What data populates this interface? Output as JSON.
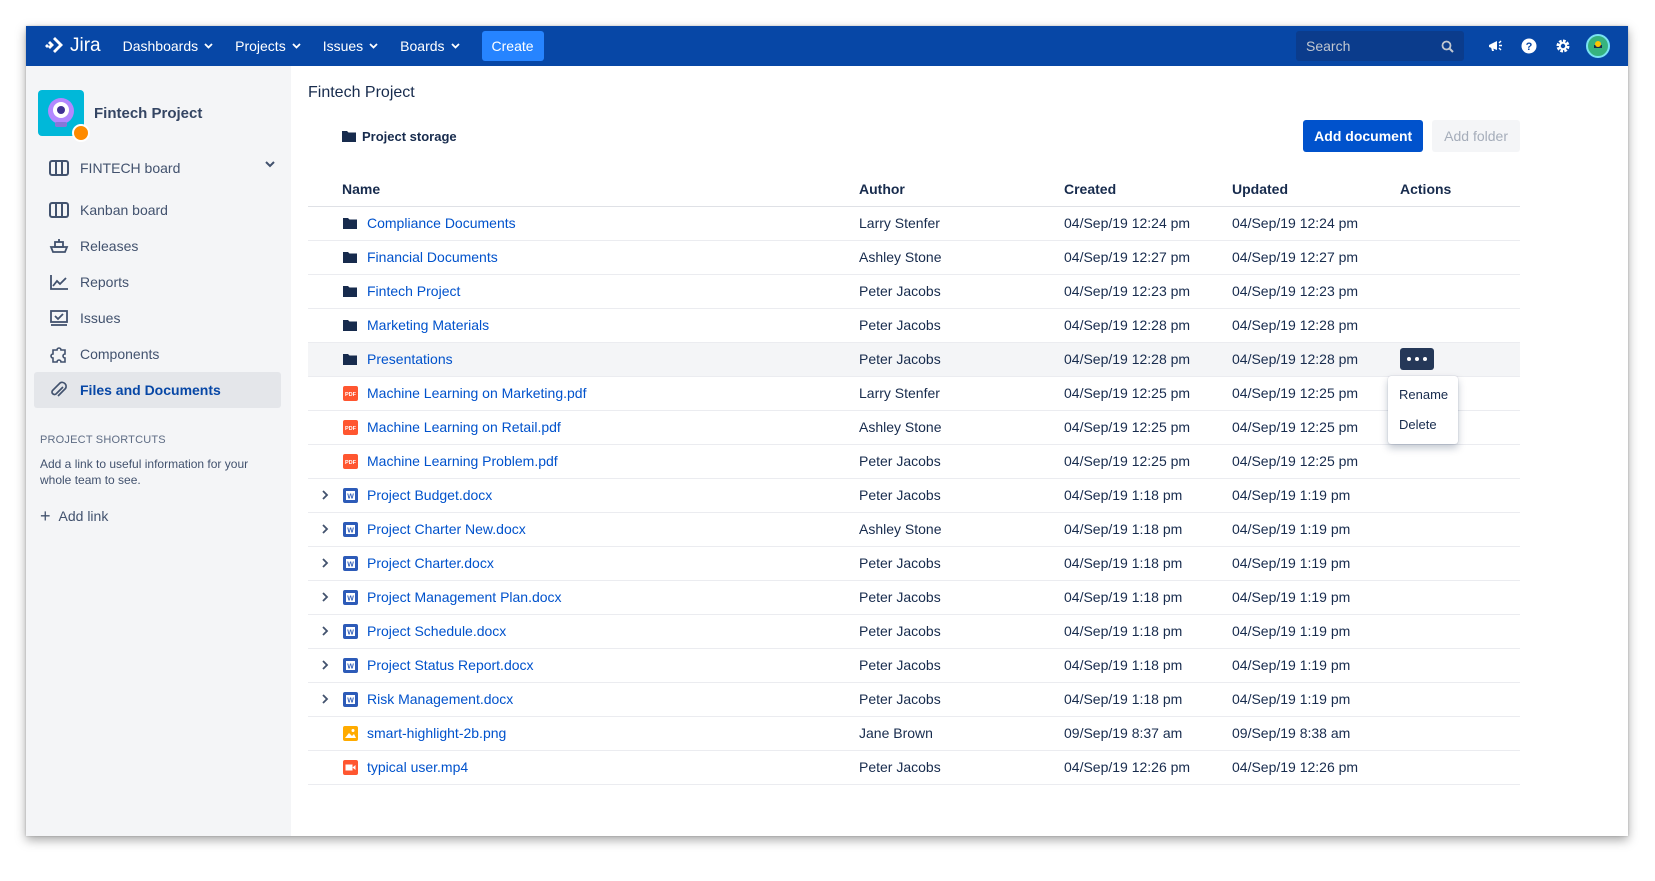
{
  "topnav": {
    "logo": "Jira",
    "menus": [
      "Dashboards",
      "Projects",
      "Issues",
      "Boards"
    ],
    "create_label": "Create",
    "search_placeholder": "Search"
  },
  "sidebar": {
    "project_name": "Fintech Project",
    "board_label": "FINTECH board",
    "items": [
      {
        "label": "Kanban board",
        "icon": "kanban-icon"
      },
      {
        "label": "Releases",
        "icon": "ship-icon"
      },
      {
        "label": "Reports",
        "icon": "chart-icon"
      },
      {
        "label": "Issues",
        "icon": "issues-icon"
      },
      {
        "label": "Components",
        "icon": "puzzle-icon"
      },
      {
        "label": "Files and Documents",
        "icon": "paperclip-icon"
      }
    ],
    "shortcuts_title": "PROJECT SHORTCUTS",
    "shortcuts_text": "Add a link to useful information for your whole team to see.",
    "add_link_label": "Add link"
  },
  "main": {
    "title": "Fintech Project",
    "storage_label": "Project storage",
    "add_document_label": "Add document",
    "add_folder_label": "Add folder",
    "columns": {
      "name": "Name",
      "author": "Author",
      "created": "Created",
      "updated": "Updated",
      "actions": "Actions"
    },
    "rows": [
      {
        "type": "folder",
        "name": "Compliance Documents",
        "author": "Larry Stenfer",
        "created": "04/Sep/19 12:24 pm",
        "updated": "04/Sep/19 12:24 pm"
      },
      {
        "type": "folder",
        "name": "Financial Documents",
        "author": "Ashley Stone",
        "created": "04/Sep/19 12:27 pm",
        "updated": "04/Sep/19 12:27 pm"
      },
      {
        "type": "folder",
        "name": "Fintech Project",
        "author": "Peter Jacobs",
        "created": "04/Sep/19 12:23 pm",
        "updated": "04/Sep/19 12:23 pm"
      },
      {
        "type": "folder",
        "name": "Marketing Materials",
        "author": "Peter Jacobs",
        "created": "04/Sep/19 12:28 pm",
        "updated": "04/Sep/19 12:28 pm"
      },
      {
        "type": "folder",
        "name": "Presentations",
        "author": "Peter Jacobs",
        "created": "04/Sep/19 12:28 pm",
        "updated": "04/Sep/19 12:28 pm"
      },
      {
        "type": "pdf",
        "name": "Machine Learning on Marketing.pdf",
        "author": "Larry Stenfer",
        "created": "04/Sep/19 12:25 pm",
        "updated": "04/Sep/19 12:25 pm"
      },
      {
        "type": "pdf",
        "name": "Machine Learning on Retail.pdf",
        "author": "Ashley Stone",
        "created": "04/Sep/19 12:25 pm",
        "updated": "04/Sep/19 12:25 pm"
      },
      {
        "type": "pdf",
        "name": "Machine Learning Problem.pdf",
        "author": "Peter Jacobs",
        "created": "04/Sep/19 12:25 pm",
        "updated": "04/Sep/19 12:25 pm"
      },
      {
        "type": "docx",
        "name": "Project Budget.docx",
        "author": "Peter Jacobs",
        "created": "04/Sep/19 1:18 pm",
        "updated": "04/Sep/19 1:19 pm"
      },
      {
        "type": "docx",
        "name": "Project Charter New.docx",
        "author": "Ashley Stone",
        "created": "04/Sep/19 1:18 pm",
        "updated": "04/Sep/19 1:19 pm"
      },
      {
        "type": "docx",
        "name": "Project Charter.docx",
        "author": "Peter Jacobs",
        "created": "04/Sep/19 1:18 pm",
        "updated": "04/Sep/19 1:19 pm"
      },
      {
        "type": "docx",
        "name": "Project Management Plan.docx",
        "author": "Peter Jacobs",
        "created": "04/Sep/19 1:18 pm",
        "updated": "04/Sep/19 1:19 pm"
      },
      {
        "type": "docx",
        "name": "Project Schedule.docx",
        "author": "Peter Jacobs",
        "created": "04/Sep/19 1:18 pm",
        "updated": "04/Sep/19 1:19 pm"
      },
      {
        "type": "docx",
        "name": "Project Status Report.docx",
        "author": "Peter Jacobs",
        "created": "04/Sep/19 1:18 pm",
        "updated": "04/Sep/19 1:19 pm"
      },
      {
        "type": "docx",
        "name": "Risk Management.docx",
        "author": "Peter Jacobs",
        "created": "04/Sep/19 1:18 pm",
        "updated": "04/Sep/19 1:19 pm"
      },
      {
        "type": "png",
        "name": "smart-highlight-2b.png",
        "author": "Jane Brown",
        "created": "09/Sep/19 8:37 am",
        "updated": "09/Sep/19 8:38 am"
      },
      {
        "type": "mp4",
        "name": "typical user.mp4",
        "author": "Peter Jacobs",
        "created": "04/Sep/19 12:26 pm",
        "updated": "04/Sep/19 12:26 pm"
      }
    ],
    "hovered_row": 4,
    "context_menu": [
      "Rename",
      "Delete"
    ]
  },
  "colors": {
    "nav_bg": "#0747a6",
    "primary": "#0052cc",
    "link": "#0052cc",
    "pdf": "#ff5630",
    "docx": "#2d5bb8",
    "png": "#ffab00",
    "mp4": "#ff5630"
  }
}
